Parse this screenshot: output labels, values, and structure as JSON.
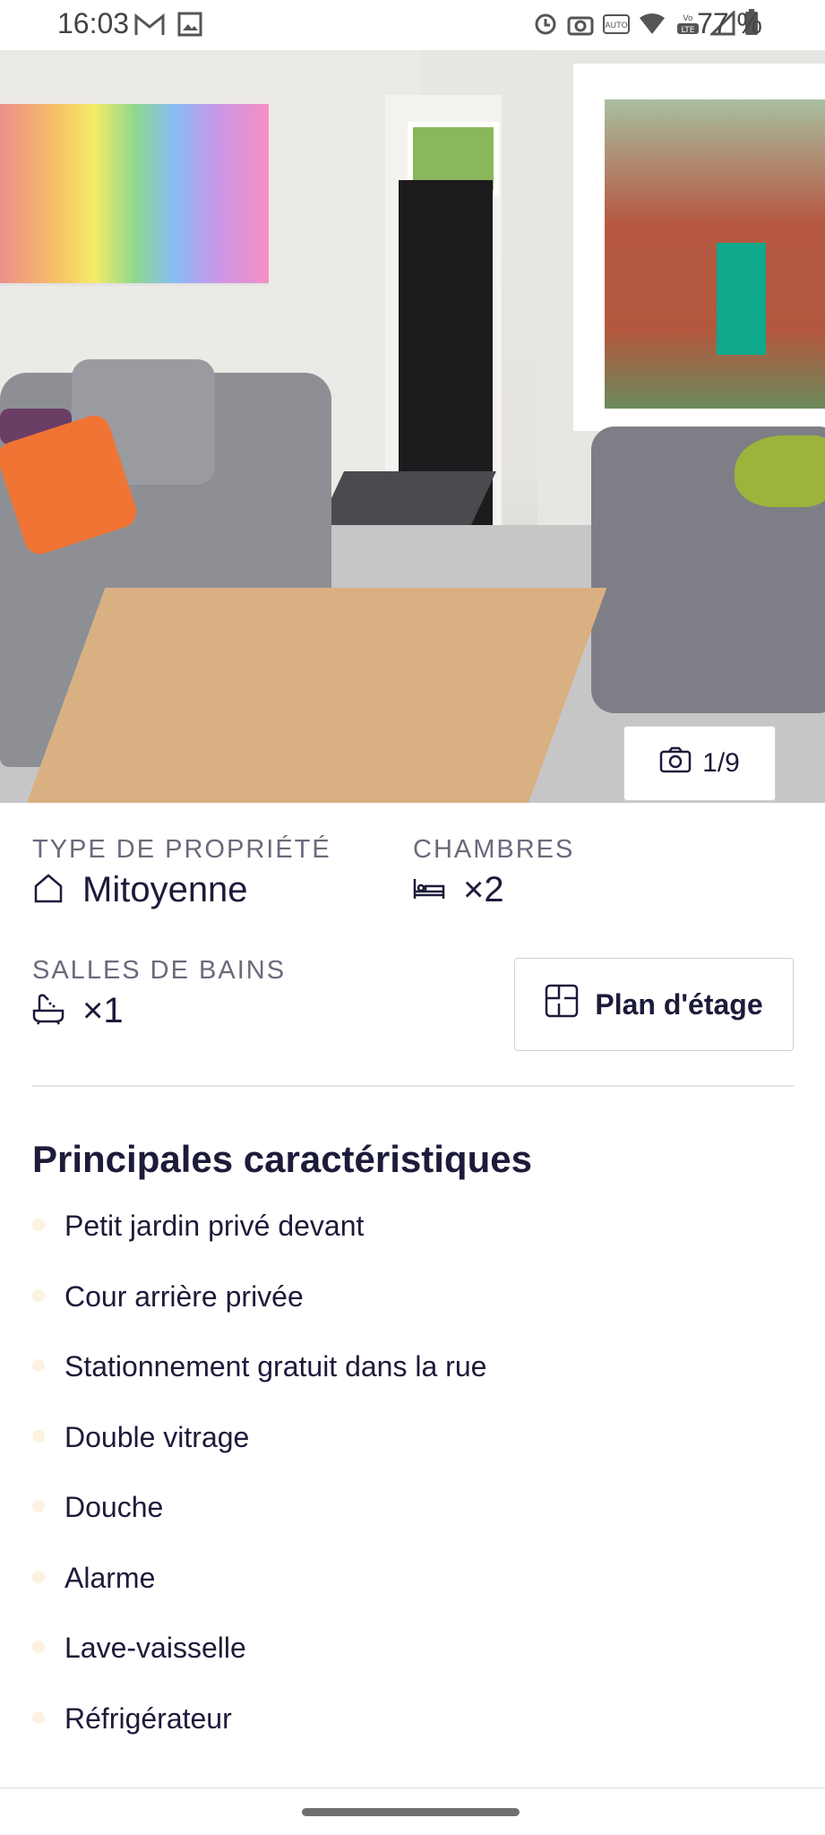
{
  "status_bar": {
    "time": "16:03",
    "battery_pct": "77 %",
    "icons_left": [
      "gmail-icon",
      "image-icon"
    ],
    "icons_right": [
      "alarm-icon",
      "camera-icon",
      "auto-hz-icon",
      "wifi-icon",
      "volte-icon",
      "signal-icon",
      "battery-icon"
    ]
  },
  "gallery": {
    "counter": "1/9",
    "counter_icon": "camera-icon"
  },
  "property": {
    "type_label": "TYPE DE PROPRIÉTÉ",
    "type_value": "Mitoyenne",
    "type_icon": "house-icon",
    "bedrooms_label": "CHAMBRES",
    "bedrooms_value": "×2",
    "bedrooms_icon": "bed-icon",
    "bathrooms_label": "SALLES DE BAINS",
    "bathrooms_value": "×1",
    "bathrooms_icon": "bathtub-icon",
    "floorplan_button": "Plan d'étage",
    "floorplan_icon": "floorplan-icon"
  },
  "features": {
    "title": "Principales caractéristiques",
    "items": [
      "Petit jardin privé devant",
      "Cour arrière privée",
      "Stationnement gratuit dans la rue",
      "Double vitrage",
      "Douche",
      "Alarme",
      "Lave-vaisselle",
      "Réfrigérateur"
    ]
  },
  "colors": {
    "text": "#1c1b3a",
    "label": "#6a6a7d",
    "bullet": "#fbf2df",
    "border": "#cfcfd6"
  }
}
